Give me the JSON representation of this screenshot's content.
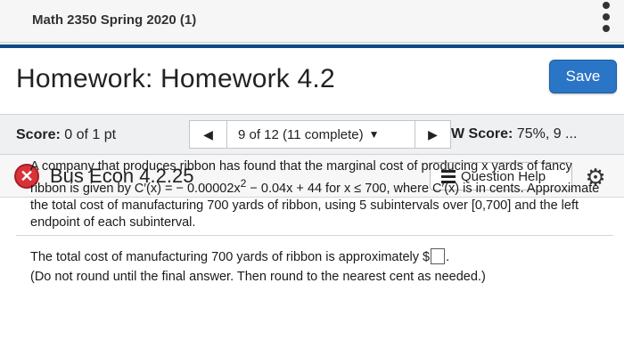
{
  "course": {
    "title": "Math 2350 Spring 2020 (1)"
  },
  "homework": {
    "title": "Homework: Homework 4.2",
    "save_label": "Save"
  },
  "scorebar": {
    "score_label": "Score:",
    "score_value": "0 of 1 pt",
    "prev_icon": "◀",
    "question_select": "9 of 12 (11 complete)",
    "select_caret": "▼",
    "next_icon": "▶",
    "hw_score_label": "W Score:",
    "hw_score_value": "75%, 9 ..."
  },
  "question": {
    "status_icon": "x-circle-icon",
    "status_color": "#d9333a",
    "name": "Bus Econ 4.2.25",
    "help_label": "Question Help",
    "settings_icon": "gear-icon",
    "text_before_exp": "A company that produces ribbon has found that the marginal cost of producing x yards of fancy ribbon is given by C′(x) = − 0.00002x",
    "exponent": "2",
    "text_after_exp": " − 0.04x + 44 for x ≤ 700, where C′(x) is in cents. Approximate the total cost of manufacturing 700 yards of ribbon, using 5 subintervals over [0,700] and the left endpoint of each subinterval.",
    "answer_prompt": "The total cost of manufacturing 700 yards of ribbon is approximately $",
    "answer_suffix": ".",
    "answer_value": "",
    "instruction": "(Do not round until the final answer. Then round to the nearest cent as needed.)"
  },
  "colors": {
    "accent": "#0f4a86",
    "save_button": "#2b75c6"
  }
}
